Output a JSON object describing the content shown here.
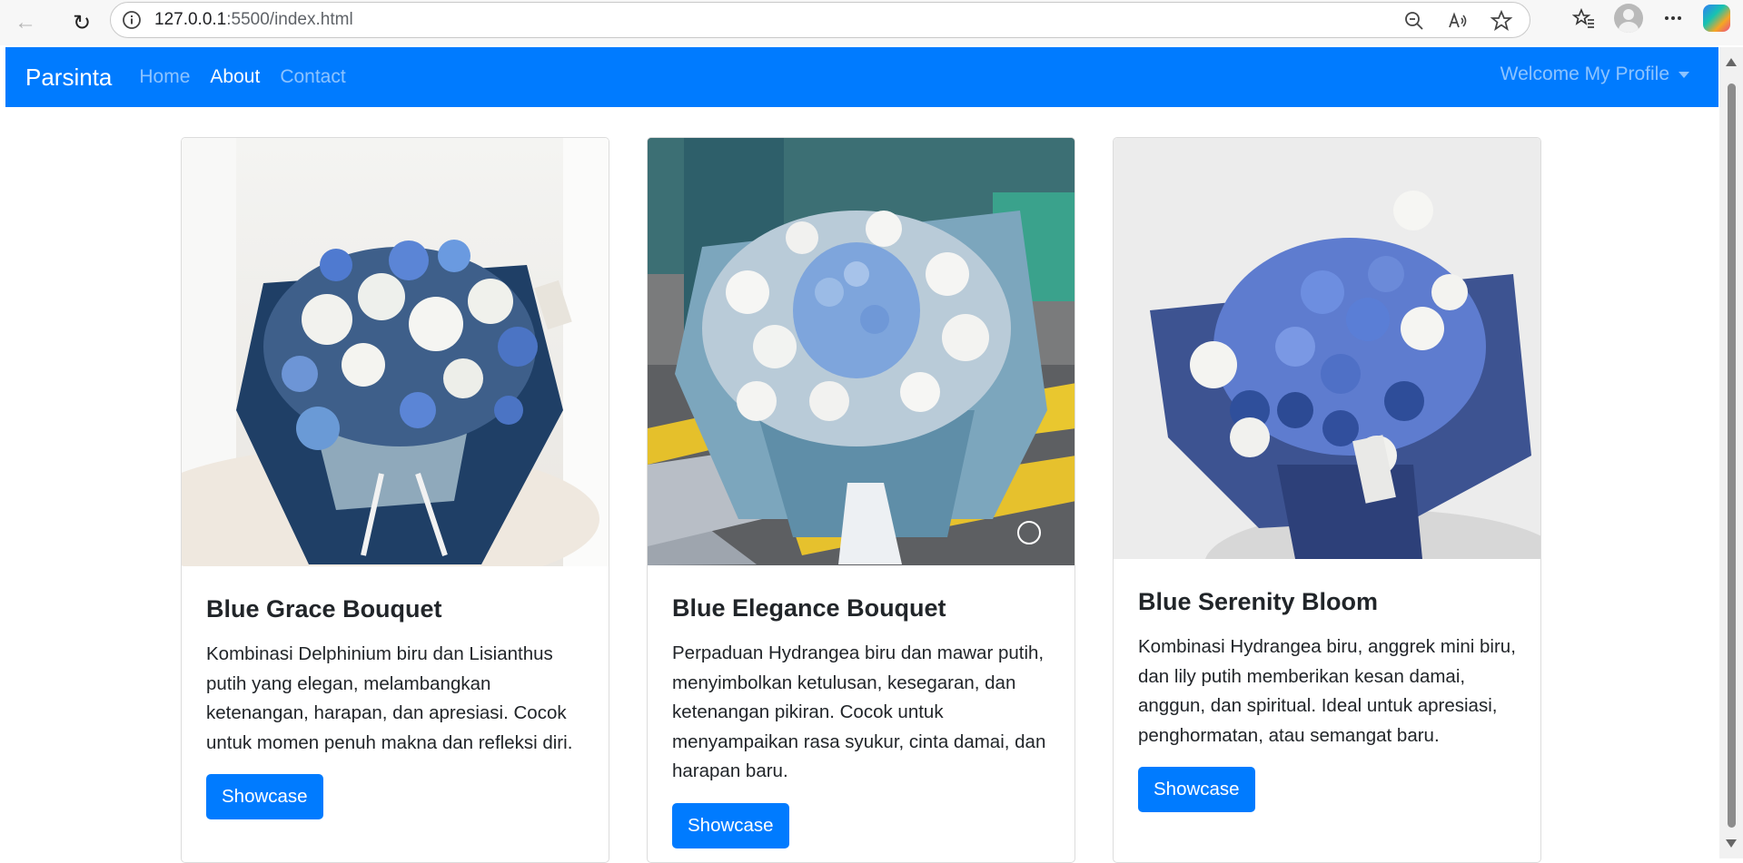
{
  "browser": {
    "url_host": "127.0.0.1",
    "url_rest": ":5500/index.html"
  },
  "navbar": {
    "brand": "Parsinta",
    "links": [
      {
        "label": "Home",
        "active": false
      },
      {
        "label": "About",
        "active": true
      },
      {
        "label": "Contact",
        "active": false
      }
    ],
    "profile_label": "Welcome My Profile"
  },
  "cards": [
    {
      "title": "Blue Grace Bouquet",
      "text": "Kombinasi Delphinium biru dan Lisianthus putih yang elegan, melambangkan ketenangan, harapan, dan apresiasi. Cocok untuk momen penuh makna dan refleksi diri.",
      "button": "Showcase"
    },
    {
      "title": "Blue Elegance Bouquet",
      "text": "Perpaduan Hydrangea biru dan mawar putih, menyimbolkan ketulusan, kesegaran, dan ketenangan pikiran. Cocok untuk menyampaikan rasa syukur, cinta damai, dan harapan baru.",
      "button": "Showcase"
    },
    {
      "title": "Blue Serenity Bloom",
      "text": "Kombinasi Hydrangea biru, anggrek mini biru, dan lily putih memberikan kesan damai, anggun, dan spiritual. Ideal untuk apresiasi, penghormatan, atau semangat baru.",
      "button": "Showcase"
    }
  ],
  "colors": {
    "primary": "#007bff",
    "bouquet_navy": "#1f3f66",
    "bouquet_blue": "#5b85d6"
  }
}
